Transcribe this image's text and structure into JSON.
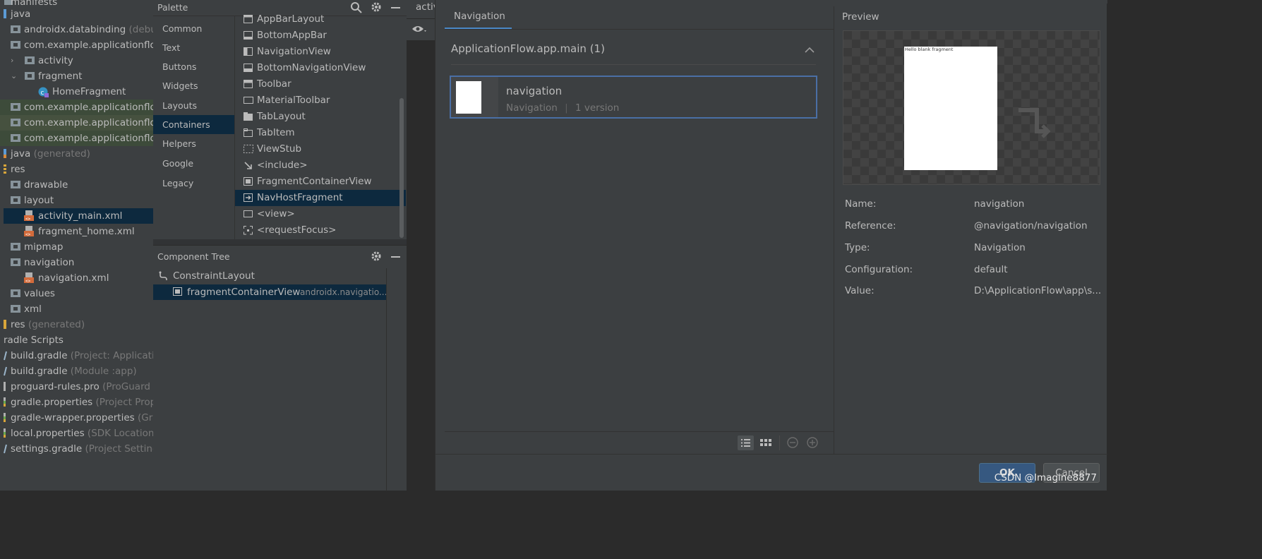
{
  "project_tree": {
    "rows": [
      {
        "label": "manifests",
        "muted": ""
      },
      {
        "label": "java",
        "muted": ""
      },
      {
        "label": "androidx.databinding",
        "muted": " (debug)"
      },
      {
        "label": "com.example.applicationflow",
        "muted": ""
      },
      {
        "label": "activity",
        "muted": ""
      },
      {
        "label": "fragment",
        "muted": ""
      },
      {
        "label": "HomeFragment",
        "muted": ""
      },
      {
        "label": "com.example.applicationflow",
        "muted": ""
      },
      {
        "label": "com.example.applicationflow",
        "muted": ""
      },
      {
        "label": "com.example.applicationflow",
        "muted": ""
      },
      {
        "label": "java",
        "muted": " (generated)"
      },
      {
        "label": "res",
        "muted": ""
      },
      {
        "label": "drawable",
        "muted": ""
      },
      {
        "label": "layout",
        "muted": ""
      },
      {
        "label": "activity_main.xml",
        "muted": ""
      },
      {
        "label": "fragment_home.xml",
        "muted": ""
      },
      {
        "label": "mipmap",
        "muted": ""
      },
      {
        "label": "navigation",
        "muted": ""
      },
      {
        "label": "navigation.xml",
        "muted": ""
      },
      {
        "label": "values",
        "muted": ""
      },
      {
        "label": "xml",
        "muted": ""
      },
      {
        "label": "res",
        "muted": " (generated)"
      },
      {
        "label": "radle Scripts",
        "muted": ""
      },
      {
        "label": "build.gradle",
        "muted": " (Project: ApplicationFlow)"
      },
      {
        "label": "build.gradle",
        "muted": " (Module :app)"
      },
      {
        "label": "proguard-rules.pro",
        "muted": " (ProGuard Rules)"
      },
      {
        "label": "gradle.properties",
        "muted": " (Project Properties)"
      },
      {
        "label": "gradle-wrapper.properties",
        "muted": " (Gradle)"
      },
      {
        "label": "local.properties",
        "muted": " (SDK Location)"
      },
      {
        "label": "settings.gradle",
        "muted": " (Project Settings)"
      }
    ]
  },
  "palette": {
    "title": "Palette",
    "categories": [
      "Common",
      "Text",
      "Buttons",
      "Widgets",
      "Layouts",
      "Containers",
      "Helpers",
      "Google",
      "Legacy"
    ],
    "selected_category": "Containers",
    "items": [
      "AppBarLayout",
      "BottomAppBar",
      "NavigationView",
      "BottomNavigationView",
      "Toolbar",
      "MaterialToolbar",
      "TabLayout",
      "TabItem",
      "ViewStub",
      "<include>",
      "FragmentContainerView",
      "NavHostFragment",
      "<view>",
      "<requestFocus>"
    ],
    "selected_item": "NavHostFragment"
  },
  "component_tree": {
    "title": "Component Tree",
    "root": "ConstraintLayout",
    "child": "fragmentContainerView",
    "child_class": "androidx.navigatio..."
  },
  "editor": {
    "tab_label": "activ"
  },
  "dialog": {
    "tab": "Navigation",
    "group_title": "ApplicationFlow.app.main (1)",
    "resource": {
      "name": "navigation",
      "type": "Navigation",
      "sep": "|",
      "versions": "1 version"
    },
    "preview": {
      "title": "Preview",
      "phone_text": "Hello blank fragment"
    },
    "properties": [
      {
        "key": "Name:",
        "value": "navigation"
      },
      {
        "key": "Reference:",
        "value": "@navigation/navigation"
      },
      {
        "key": "Type:",
        "value": "Navigation"
      },
      {
        "key": "Configuration:",
        "value": "default"
      },
      {
        "key": "Value:",
        "value": "D:\\ApplicationFlow\\app\\s..."
      }
    ],
    "ok_label": "OK",
    "cancel_label": "Cancel"
  },
  "watermark": "CSDN @Imagine8877"
}
